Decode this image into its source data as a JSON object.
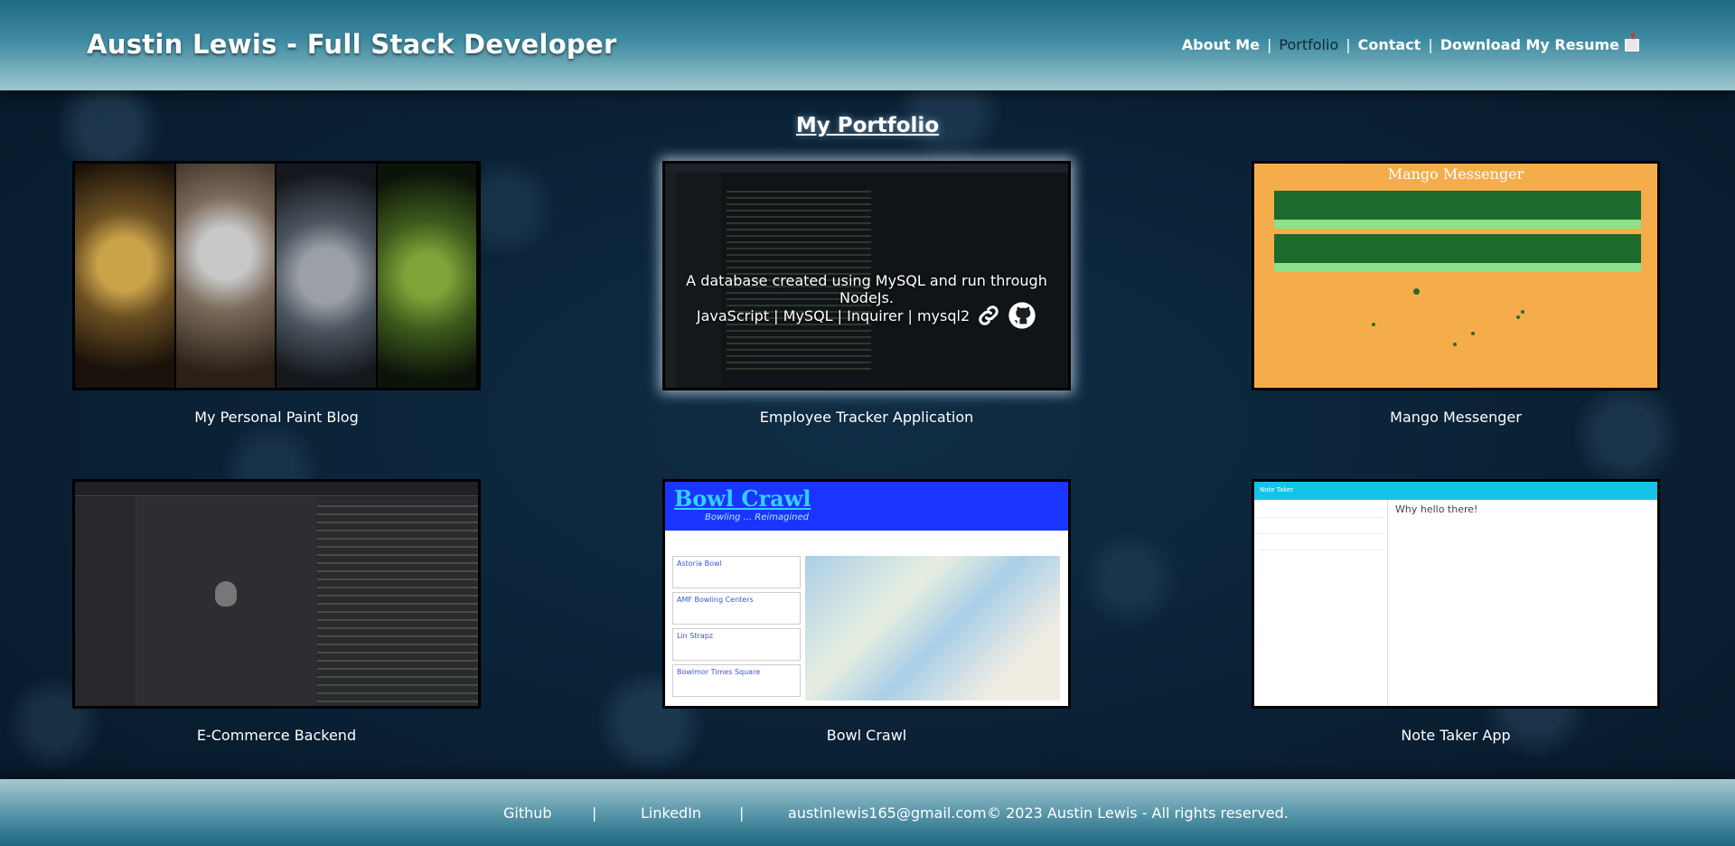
{
  "header": {
    "title": "Austin Lewis - Full Stack Developer",
    "nav": {
      "about": "About Me",
      "portfolio": "Portfolio",
      "contact": "Contact",
      "resume": "Download My Resume",
      "separator": "|"
    }
  },
  "main": {
    "heading": "My Portfolio",
    "projects": [
      {
        "label": "My Personal Paint Blog"
      },
      {
        "label": "Employee Tracker Application",
        "description": "A database created using MySQL and run through NodeJs.",
        "tech": "JavaScript | MySQL | Inquirer | mysql2"
      },
      {
        "label": "Mango Messenger",
        "image_title": "Mango Messenger"
      },
      {
        "label": "E-Commerce Backend"
      },
      {
        "label": "Bowl Crawl",
        "image_title": "Bowl Crawl",
        "image_subtitle": "Bowling ... Reimagined",
        "venues": [
          "Astoria Bowl",
          "AMF Bowling Centers",
          "Lin Strapz",
          "Bowlmor Times Square"
        ]
      },
      {
        "label": "Note Taker App",
        "image_title": "Note Taker",
        "note_title": "Why hello there!"
      }
    ]
  },
  "footer": {
    "github": "Github",
    "linkedin": "LinkedIn",
    "email": "austinlewis165@gmail.com",
    "copyright": "© 2023 Austin Lewis - All rights reserved.",
    "separator": "|"
  },
  "colors": {
    "header_top": "#1f6a84",
    "background": "#0b2133",
    "mango_orange": "#f5ad4c",
    "bowl_blue": "#1a35ff",
    "note_cyan": "#16c3e8"
  }
}
